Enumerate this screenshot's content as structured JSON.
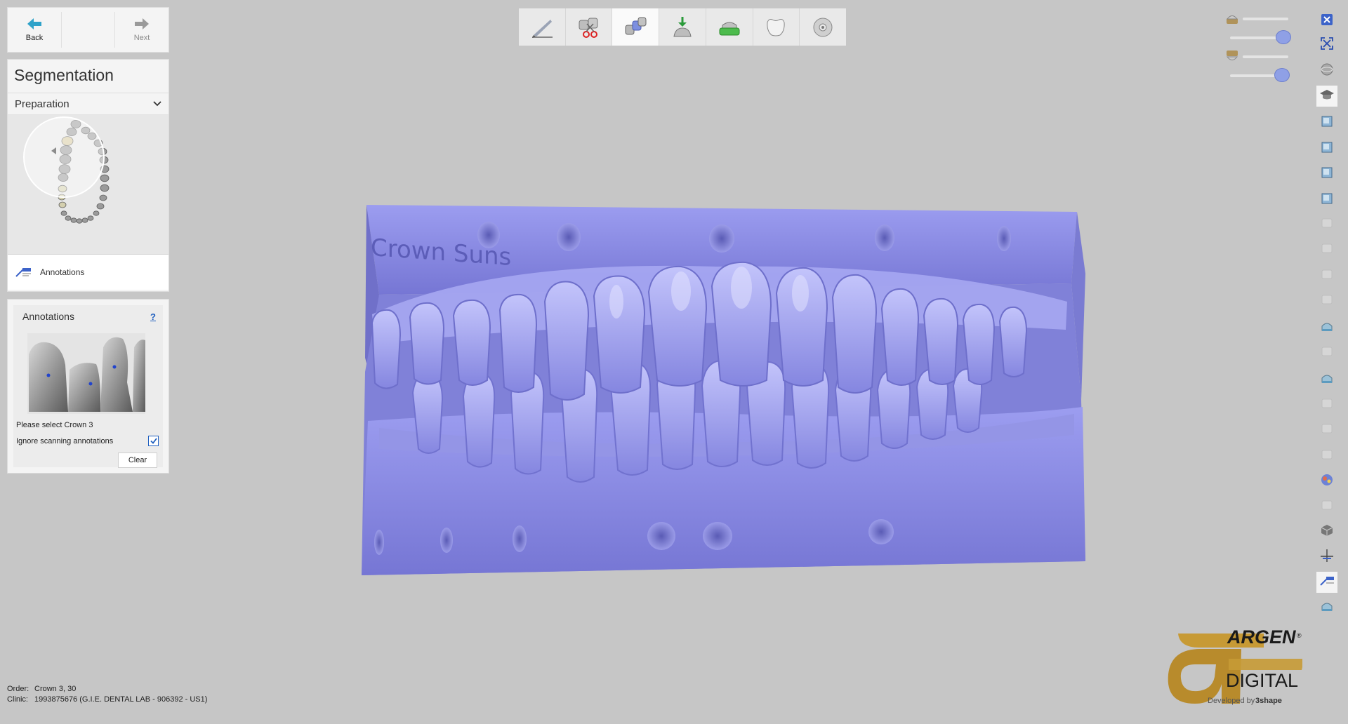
{
  "nav": {
    "back": "Back",
    "next": "Next"
  },
  "segmentation": {
    "title": "Segmentation",
    "dropdown": "Preparation",
    "annotations_row": "Annotations"
  },
  "annotations_panel": {
    "title": "Annotations",
    "help": "?",
    "message": "Please select Crown 3",
    "checkbox_label": "Ignore scanning annotations",
    "checkbox_checked": true,
    "clear_button": "Clear"
  },
  "toolbar": {
    "steps": [
      "pen-icon",
      "cut-scissors-icon",
      "segmentation-icon",
      "import-icon",
      "model-base-icon",
      "crown-icon",
      "disc-icon"
    ],
    "active_index": 2
  },
  "footer": {
    "order_label": "Order:",
    "order_value": "Crown 3, 30",
    "clinic_label": "Clinic:",
    "clinic_value": "1993875676 (G.I.E. DENTAL LAB - 906392 - US1)"
  },
  "logo": {
    "brand_top": "ARGEN",
    "registered": "®",
    "brand_bottom": "DIGITAL",
    "tagline": "Developed by",
    "tagline_brand": "3shape"
  },
  "model_engraving": "Crown Suns",
  "colors": {
    "model": "#8c8de8",
    "accent": "#1f5fbf",
    "active_knob": "#8fa0e6"
  }
}
